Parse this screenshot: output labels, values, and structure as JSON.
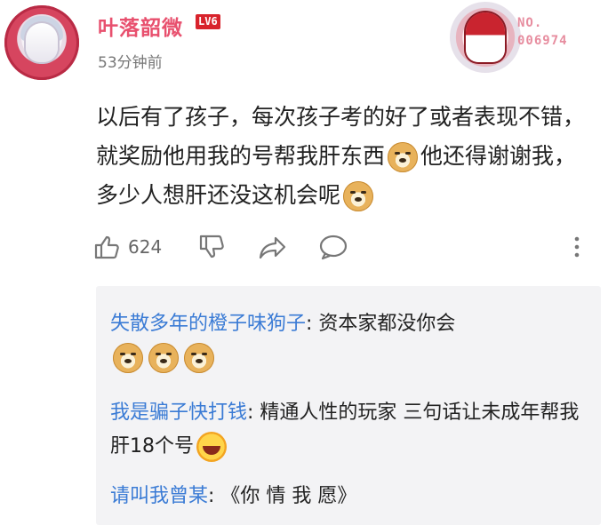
{
  "header": {
    "username": "叶落韶微",
    "level_badge": "LV6",
    "timestamp": "53分钟前",
    "medal_no_label": "NO.",
    "medal_no_value": "006974"
  },
  "comment": {
    "text_part1": "以后有了孩子，每次孩子考的好了或者表现不错，就奖励他用我的号帮我肝东西",
    "text_part2": "他还得谢谢我，多少人想肝还没这机会呢",
    "emojis": [
      "doge",
      "doge"
    ]
  },
  "actions": {
    "like_count": "624",
    "icons": [
      "thumbs-up-icon",
      "thumbs-down-icon",
      "share-icon",
      "comment-icon",
      "more-vertical-icon"
    ]
  },
  "replies": [
    {
      "name": "失散多年的橙子味狗子",
      "separator": ":",
      "text": " 资本家都没你会",
      "emojis": [
        "doge",
        "doge",
        "doge"
      ]
    },
    {
      "name": "我是骗子快打钱",
      "separator": ":",
      "text": " 精通人性的玩家 三句话让未成年帮我肝18个号",
      "emojis": [
        "laugh"
      ]
    },
    {
      "name": "请叫我曾某",
      "separator": ":",
      "text": " 《你 情 我 愿》",
      "emojis": []
    }
  ],
  "colors": {
    "username": "#e8506e",
    "reply_name": "#3a7bd5",
    "level_badge_bg": "#d8232c",
    "reply_panel_bg": "#f3f3f5"
  }
}
